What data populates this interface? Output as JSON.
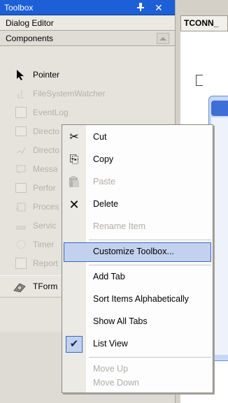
{
  "toolbox": {
    "title": "Toolbox",
    "pin_glyph": "⊥",
    "close_glyph": "✕",
    "sections": {
      "dialog_editor": "Dialog Editor",
      "components": "Components"
    },
    "items": [
      {
        "label": "Pointer",
        "icon": "pointer-arrow-icon"
      },
      {
        "label": "FileSystemWatcher",
        "icon": "filesystemwatcher-icon"
      },
      {
        "label": "EventLog",
        "icon": "eventlog-icon"
      },
      {
        "label": "Directo",
        "icon": "directory-entry-icon"
      },
      {
        "label": "Directo",
        "icon": "directory-searcher-icon"
      },
      {
        "label": "Messa",
        "icon": "message-queue-icon"
      },
      {
        "label": "Perfor",
        "icon": "performance-counter-icon"
      },
      {
        "label": "Proces",
        "icon": "process-icon"
      },
      {
        "label": "Servic",
        "icon": "service-controller-icon"
      },
      {
        "label": "Timer",
        "icon": "timer-icon"
      },
      {
        "label": "Report",
        "icon": "report-document-icon"
      },
      {
        "label": "TForm",
        "icon": "tform-gear-icon"
      }
    ]
  },
  "designer": {
    "tab_label": "TCONN_"
  },
  "context_menu": {
    "items": [
      {
        "label": "Cut",
        "icon": "scissors-icon",
        "glyph": "✂",
        "enabled": true
      },
      {
        "label": "Copy",
        "icon": "copy-icon",
        "glyph": "⎘",
        "enabled": true
      },
      {
        "label": "Paste",
        "icon": "paste-icon",
        "glyph": "📋",
        "enabled": false
      },
      {
        "label": "Delete",
        "icon": "delete-x-icon",
        "glyph": "✕",
        "enabled": true
      },
      {
        "label": "Rename Item",
        "enabled": false
      },
      {
        "label": "Customize Toolbox...",
        "enabled": true,
        "highlighted": true
      },
      {
        "label": "Add Tab",
        "enabled": true
      },
      {
        "label": "Sort Items Alphabetically",
        "enabled": true
      },
      {
        "label": "Show All Tabs",
        "enabled": true
      },
      {
        "label": "List View",
        "enabled": true,
        "checked": true,
        "check_glyph": "✔"
      },
      {
        "label": "Move Up",
        "enabled": false
      },
      {
        "label": "Move Down",
        "enabled": false
      }
    ]
  },
  "colors": {
    "titlebar": "#1c5fd6",
    "highlight_fill": "#c2d2ee",
    "highlight_border": "#3a64c2",
    "disabled_text": "#b0ada6"
  }
}
